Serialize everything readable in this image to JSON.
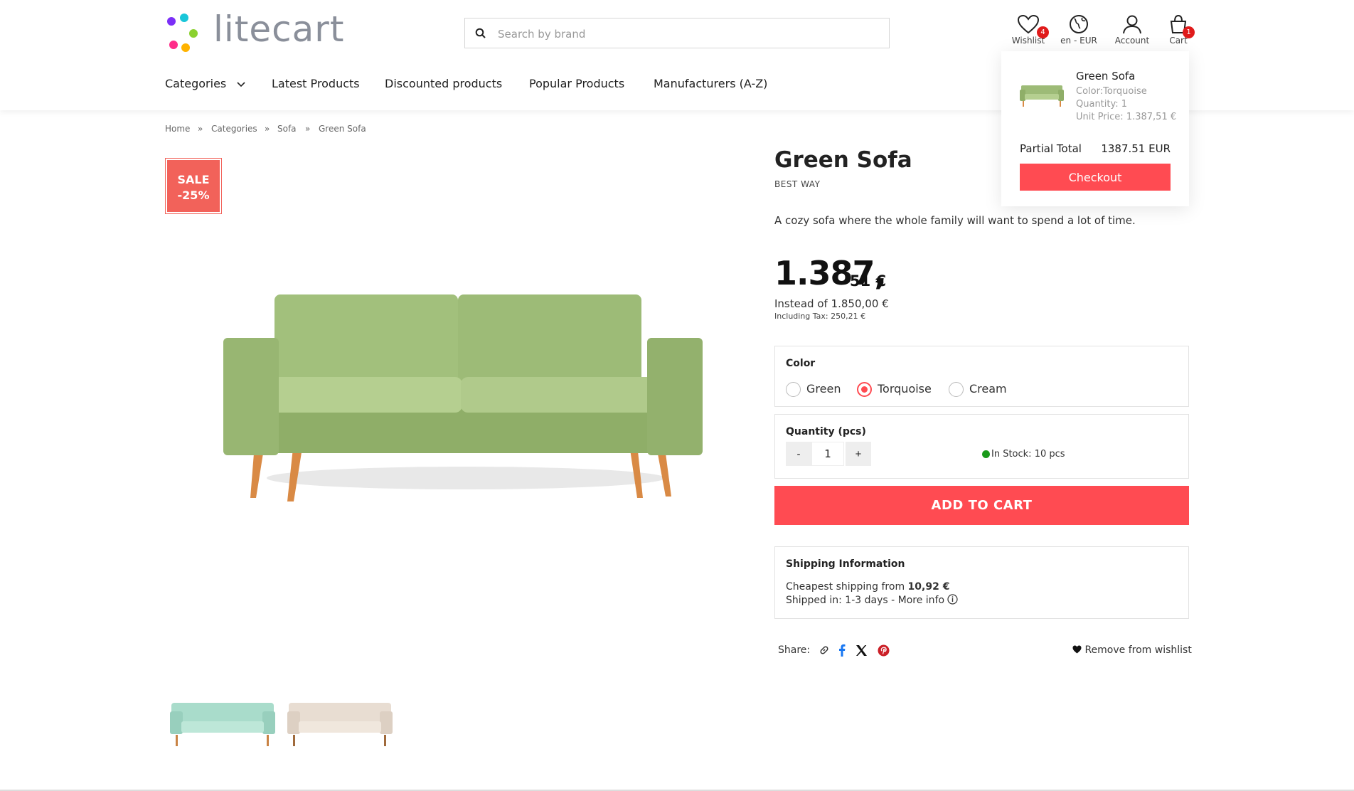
{
  "header": {
    "logo_text": "litecart",
    "search": {
      "placeholder": "Search by brand"
    },
    "icons": {
      "wishlist_label": "Wishlist",
      "wishlist_count": "4",
      "locale_label": "en - EUR",
      "account_label": "Account",
      "cart_label": "Cart",
      "cart_count": "1"
    },
    "nav": [
      "Categories",
      "Latest Products",
      "Discounted products",
      "Popular Products",
      "Manufacturers (A-Z)"
    ]
  },
  "cart_popup": {
    "item_name": "Green Sofa",
    "item_color": "Color:Torquoise",
    "item_quantity": "Quantity: 1",
    "item_unit_price": "Unit Price: 1.387,51 €",
    "partial_total_label": "Partial Total",
    "partial_total_value": "1387.51 EUR",
    "checkout_label": "Checkout"
  },
  "breadcrumb": [
    "Home",
    "Categories",
    "Sofa",
    "Green Sofa"
  ],
  "breadcrumb_separator": "»",
  "sale_badge": {
    "line1": "SALE",
    "line2": "-25%"
  },
  "product": {
    "title": "Green Sofa",
    "brand": "BEST WAY",
    "description": "A cozy sofa where the whole family will want to spend a lot of time.",
    "price_main": "1.387,",
    "price_cents": "51 €",
    "instead_of": "Instead of 1.850,00 €",
    "tax": "Including Tax: 250,21 €"
  },
  "options": {
    "color_label": "Color",
    "colors": [
      "Green",
      "Torquoise",
      "Cream"
    ],
    "selected_color": "Torquoise"
  },
  "quantity": {
    "label": "Quantity (pcs)",
    "minus": "-",
    "value": "1",
    "plus": "+",
    "stock": "In Stock: 10 pcs"
  },
  "add_to_cart_label": "ADD TO CART",
  "shipping": {
    "title": "Shipping Information",
    "cheapest_prefix": "Cheapest shipping from",
    "cheapest_value": "10,92 €",
    "shipped_in": "Shipped in: 1-3 days - More info"
  },
  "share": {
    "label": "Share:",
    "remove_wishlist": "Remove from wishlist"
  },
  "colors": {
    "accent": "#ff4b52",
    "sale": "#f2625a",
    "badge": "#e01b1b",
    "stock": "#1a9a1a",
    "facebook": "#1877f2",
    "pinterest": "#cb1f27"
  }
}
